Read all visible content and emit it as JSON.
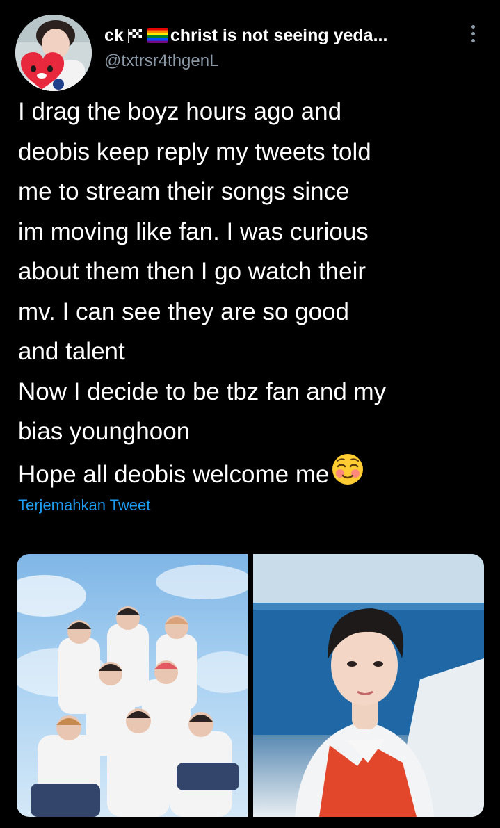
{
  "tweet": {
    "display_name": "ck",
    "display_name_suffix": "christ is not seeing yeda...",
    "handle": "@txtrsr4thgenL",
    "text_lines": [
      "I drag the boyz hours ago and",
      "deobis keep reply my tweets told",
      "me to stream their songs since",
      "im moving like fan. I was curious",
      "about them then I go watch their",
      "mv. I can see they are so good",
      "and talent",
      "Now I decide to be tbz fan and my",
      "bias younghoon",
      "Hope all deobis welcome me"
    ],
    "translate_label": "Terjemahkan Tweet"
  },
  "icons": {
    "more": "more-vertical-icon",
    "flag": "checkered-flag-icon",
    "rainbow": "rainbow-flag-icon",
    "emoji": "smiling-blush-emoji-icon"
  },
  "colors": {
    "background": "#000000",
    "text": "#ffffff",
    "secondary_text": "#8b98a5",
    "link": "#1d9bf0"
  }
}
